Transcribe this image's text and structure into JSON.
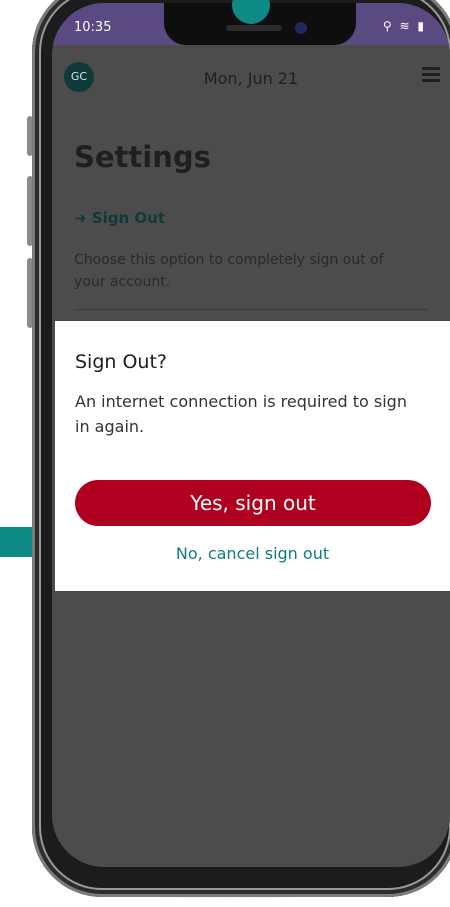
{
  "status_bar": {
    "time": "10:35",
    "icons": "⚲ ≋ ▮"
  },
  "app_bar": {
    "avatar_initials": "GC",
    "date": "Mon, Jun 21"
  },
  "settings": {
    "title": "Settings",
    "signout_label": "Sign Out",
    "signout_icon": "➜",
    "signout_description": "Choose this option to completely sign out of your account."
  },
  "dialog": {
    "title": "Sign Out?",
    "message": "An internet connection is required to sign in again.",
    "confirm_label": "Yes, sign out",
    "cancel_label": "No, cancel sign out"
  },
  "colors": {
    "accent_teal": "#0e8a87",
    "confirm_red": "#b00020",
    "status_bar_purple": "#5b4a82"
  }
}
